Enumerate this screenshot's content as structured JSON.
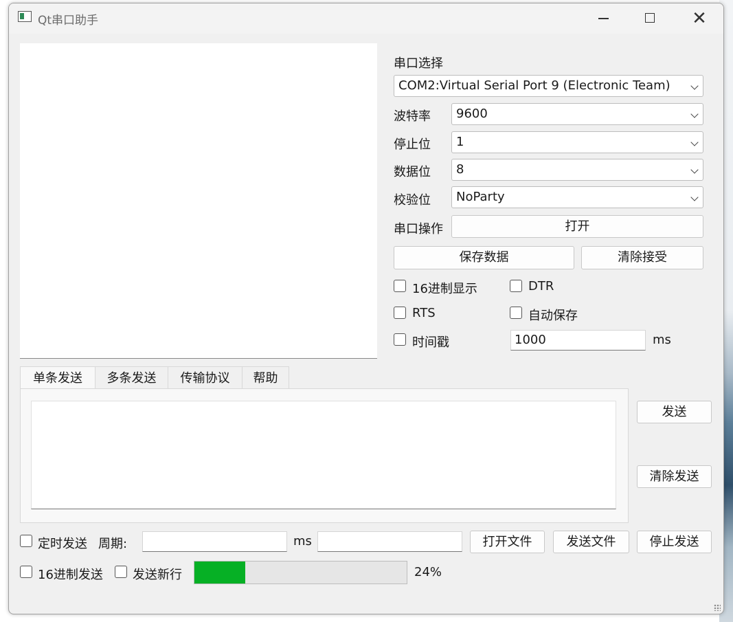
{
  "window": {
    "title": "Qt串口助手"
  },
  "serial": {
    "port_select_label": "串口选择",
    "port_value": "COM2:Virtual Serial Port 9 (Electronic Team)",
    "baud_label": "波特率",
    "baud_value": "9600",
    "stopbits_label": "停止位",
    "stopbits_value": "1",
    "databits_label": "数据位",
    "databits_value": "8",
    "parity_label": "校验位",
    "parity_value": "NoParty",
    "operation_label": "串口操作",
    "open_button": "打开",
    "save_data_button": "保存数据",
    "clear_receive_button": "清除接受"
  },
  "options": {
    "hex_display": "16进制显示",
    "dtr": "DTR",
    "rts": "RTS",
    "auto_save": "自动保存",
    "timestamp": "时间戳",
    "timestamp_value": "1000",
    "timestamp_unit": "ms"
  },
  "tabs": [
    "单条发送",
    "多条发送",
    "传输协议",
    "帮助"
  ],
  "send": {
    "send_button": "发送",
    "clear_send_button": "清除发送"
  },
  "bottom": {
    "timed_send": "定时发送",
    "period_label": "周期:",
    "period_value": "",
    "period_unit": "ms",
    "file_path": "",
    "open_file_button": "打开文件",
    "send_file_button": "发送文件",
    "stop_send_button": "停止发送",
    "hex_send": "16进制发送",
    "send_newline": "发送新行",
    "progress_percent": 24,
    "progress_text": "24%"
  },
  "colors": {
    "progress_fill": "#06b025",
    "window_bg": "#f0f0f0"
  }
}
